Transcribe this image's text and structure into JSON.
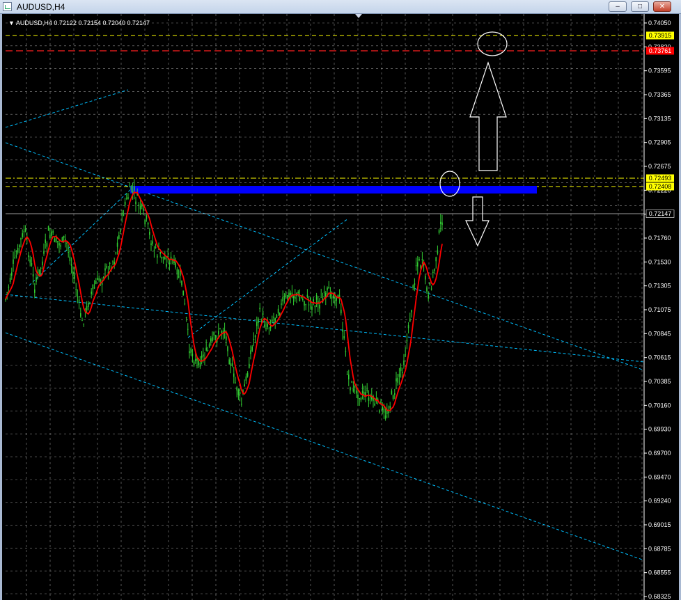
{
  "window": {
    "title": "AUDUSD,H4"
  },
  "chart": {
    "symbol_info": "AUDUSD,H4  0.72122 0.72154 0.72040 0.72147",
    "y_axis_labels": [
      "0.74050",
      "0.73820",
      "0.73595",
      "0.73365",
      "0.73135",
      "0.72905",
      "0.72675",
      "0.72220",
      "0.71990",
      "0.71760",
      "0.71530",
      "0.71305",
      "0.71075",
      "0.70845",
      "0.70615",
      "0.70385",
      "0.70160",
      "0.69930",
      "0.69700",
      "0.69470",
      "0.69240",
      "0.69015",
      "0.68785",
      "0.68555",
      "0.68325"
    ],
    "price_boxes": [
      {
        "label": "0.73915",
        "bg": "#ffff00",
        "fg": "#000000"
      },
      {
        "label": "0.73761",
        "bg": "#ff0000",
        "fg": "#ffffff"
      },
      {
        "label": "0.72493",
        "bg": "#ffff00",
        "fg": "#000000"
      },
      {
        "label": "0.72408",
        "bg": "#ffff00",
        "fg": "#000000"
      },
      {
        "label": "0.72147",
        "bg": "#000000",
        "fg": "#ffffff"
      }
    ],
    "colors": {
      "bull": "#32cd32",
      "ma": "#ff0000",
      "zone": "#0000ff",
      "trend": "#00bfff",
      "grid": "#ffffff"
    },
    "annotations": [
      "ellipse-target-upper",
      "ellipse-target-lower",
      "arrow-up-outline",
      "arrow-down-outline"
    ]
  }
}
